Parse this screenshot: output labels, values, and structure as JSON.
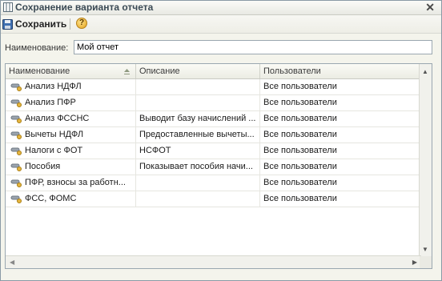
{
  "window": {
    "title": "Сохранение варианта отчета"
  },
  "toolbar": {
    "save_label": "Сохранить",
    "help_label": "?"
  },
  "form": {
    "name_label": "Наименование:",
    "name_value": "Мой отчет"
  },
  "table": {
    "columns": [
      "Наименование",
      "Описание",
      "Пользователи"
    ],
    "rows": [
      {
        "name": "Анализ НДФЛ",
        "description": "",
        "users": "Все пользователи"
      },
      {
        "name": "Анализ ПФР",
        "description": "",
        "users": "Все пользователи"
      },
      {
        "name": "Анализ ФССНС",
        "description": "Выводит базу начислений ...",
        "users": "Все пользователи"
      },
      {
        "name": "Вычеты НДФЛ",
        "description": "Предоставленные вычеты...",
        "users": "Все пользователи"
      },
      {
        "name": "Налоги с ФОТ",
        "description": "НСФОТ",
        "users": "Все пользователи"
      },
      {
        "name": "Пособия",
        "description": "Показывает пособия начи...",
        "users": "Все пользователи"
      },
      {
        "name": "ПФР, взносы за работн...",
        "description": "",
        "users": "Все пользователи"
      },
      {
        "name": "ФСС, ФОМС",
        "description": "",
        "users": "Все пользователи"
      }
    ]
  },
  "icons": {
    "title": "report-window-icon",
    "save": "floppy-disk-icon",
    "help": "help-icon",
    "sort": "sort-icon",
    "row": "report-variant-icon"
  },
  "colors": {
    "accent": "#e2a21c",
    "border": "#9aa7b0"
  }
}
